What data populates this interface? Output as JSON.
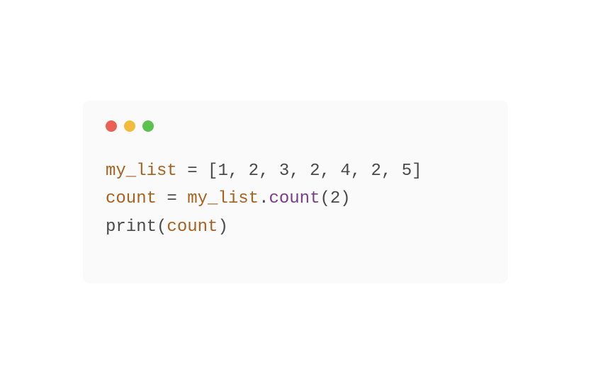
{
  "code": {
    "line1": {
      "var": "my_list",
      "eq": " = ",
      "lb": "[",
      "n1": "1",
      "c1": ", ",
      "n2": "2",
      "c2": ", ",
      "n3": "3",
      "c3": ", ",
      "n4": "2",
      "c4": ", ",
      "n5": "4",
      "c5": ", ",
      "n6": "2",
      "c6": ", ",
      "n7": "5",
      "rb": "]"
    },
    "line2": {
      "var": "count",
      "eq": " = ",
      "obj": "my_list",
      "dot": ".",
      "method": "count",
      "lp": "(",
      "arg": "2",
      "rp": ")"
    },
    "line3": {
      "call": "print",
      "lp": "(",
      "arg": "count",
      "rp": ")"
    }
  }
}
